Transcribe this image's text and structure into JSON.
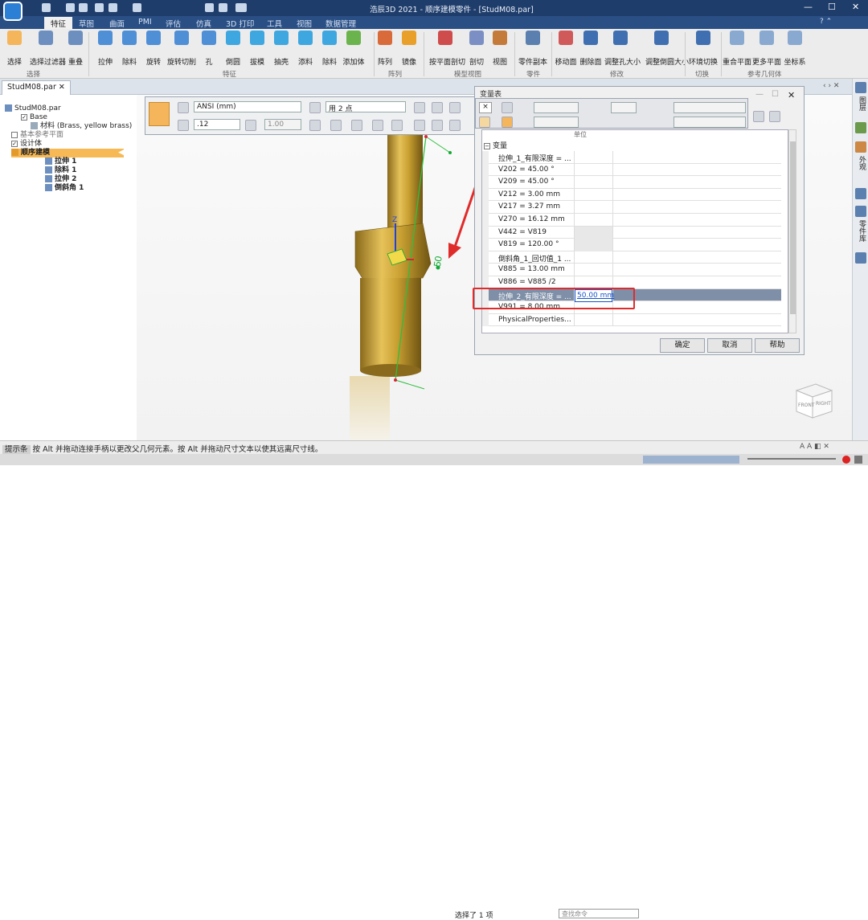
{
  "app": {
    "title": "浩辰3D 2021 - 顺序建模零件 - [StudM08.par]"
  },
  "ribbon_tabs": [
    "特征",
    "草图",
    "曲面",
    "PMI",
    "评估",
    "仿真",
    "3D 打印",
    "工具",
    "视图",
    "数据管理"
  ],
  "ribbon": {
    "groups": [
      "选择",
      "特征",
      "阵列",
      "模型视图",
      "零件",
      "修改",
      "切换",
      "参考几何体"
    ],
    "buttons": [
      {
        "label": "选择",
        "icon": "cursor-icon"
      },
      {
        "label": "选择过滤器",
        "icon": "filter-icon"
      },
      {
        "label": "重叠",
        "icon": "overlap-icon"
      },
      {
        "label": "拉伸",
        "icon": "extrude-icon"
      },
      {
        "label": "除料",
        "icon": "cut-icon"
      },
      {
        "label": "旋转",
        "icon": "revolve-icon"
      },
      {
        "label": "旋转切削",
        "icon": "revolve-cut-icon"
      },
      {
        "label": "孔",
        "icon": "hole-icon"
      },
      {
        "label": "倒圆",
        "icon": "round-icon"
      },
      {
        "label": "拔模",
        "icon": "draft-icon"
      },
      {
        "label": "抽壳",
        "icon": "shell-icon"
      },
      {
        "label": "添料",
        "icon": "add-icon"
      },
      {
        "label": "除料",
        "icon": "remove-icon"
      },
      {
        "label": "添加体",
        "icon": "add-body-icon"
      },
      {
        "label": "阵列",
        "icon": "pattern-icon"
      },
      {
        "label": "镜像",
        "icon": "mirror-icon"
      },
      {
        "label": "按平面剖切",
        "icon": "plane-section-icon"
      },
      {
        "label": "剖切",
        "icon": "section-icon"
      },
      {
        "label": "视图",
        "icon": "view-icon"
      },
      {
        "label": "零件副本",
        "icon": "part-copy-icon"
      },
      {
        "label": "移动面",
        "icon": "move-face-icon"
      },
      {
        "label": "删除面",
        "icon": "delete-face-icon"
      },
      {
        "label": "调整孔大小",
        "icon": "resize-hole-icon"
      },
      {
        "label": "调整倒圆大小",
        "icon": "resize-round-icon"
      },
      {
        "label": "环境切换",
        "icon": "env-switch-icon"
      },
      {
        "label": "重合平面",
        "icon": "coincident-plane-icon"
      },
      {
        "label": "更多平面",
        "icon": "more-planes-icon"
      },
      {
        "label": "坐标系",
        "icon": "coordinate-system-icon"
      }
    ]
  },
  "doc_tab": "StudM08.par",
  "tree": {
    "root": "StudM08.par",
    "items": [
      {
        "label": "Base",
        "checked": true
      },
      {
        "label": "材料 (Brass, yellow brass)",
        "checked": false
      },
      {
        "label": "基本参考平面",
        "checked": false
      },
      {
        "label": "设计体",
        "checked": true
      },
      {
        "label": "顺序建模",
        "section": true
      },
      {
        "label": "拉伸 1"
      },
      {
        "label": "除料 1"
      },
      {
        "label": "拉伸 2"
      },
      {
        "label": "倒斜角 1"
      }
    ]
  },
  "toolbar": {
    "standard": "ANSI (mm)",
    "mode": "用 2 点",
    "precision": ".12",
    "scale": "1.00"
  },
  "dialog": {
    "title": "变量表",
    "column": "单位",
    "group": "变量",
    "rows": [
      {
        "name": "拉伸_1_有限深度 = ...",
        "value": ""
      },
      {
        "name": "V202 = 45.00 °",
        "value": ""
      },
      {
        "name": "V209 = 45.00 °",
        "value": ""
      },
      {
        "name": "V212 = 3.00 mm",
        "value": ""
      },
      {
        "name": "V217 = 3.27 mm",
        "value": ""
      },
      {
        "name": "V270 = 16.12 mm",
        "value": ""
      },
      {
        "name": "V442 = V819",
        "value": ""
      },
      {
        "name": "V819 = 120.00 °",
        "value": ""
      },
      {
        "name": "倒斜角_1_回切值_1 ...",
        "value": ""
      },
      {
        "name": "V885 = 13.00 mm",
        "value": ""
      },
      {
        "name": "V886 = V885 /2",
        "value": ""
      },
      {
        "name": "拉伸_2_有限深度 = ...",
        "value": "50.00 mm"
      },
      {
        "name": "V991 = 8.00 mm",
        "value": ""
      },
      {
        "name": "PhysicalProperties...",
        "value": ""
      }
    ],
    "ok": "确定",
    "cancel": "取消",
    "help": "帮助"
  },
  "model": {
    "dimension": "50",
    "axis_z": "Z",
    "cube_left": "FRONT",
    "cube_right": "RIGHT"
  },
  "sidebar": [
    "图层",
    "外观",
    "零件库"
  ],
  "status": {
    "hint_label": "提示条",
    "hint": "按 Alt 并拖动连接手柄以更改父几何元素。按 Alt 并拖动尺寸文本以使其远离尺寸线。",
    "selected": "选择了 1 项",
    "command_placeholder": "查找命令"
  },
  "colors": {
    "accent": "#f5b55a",
    "highlight": "#e02b2b",
    "titlebar": "#1f3d6b",
    "brass": "#c9a032"
  }
}
